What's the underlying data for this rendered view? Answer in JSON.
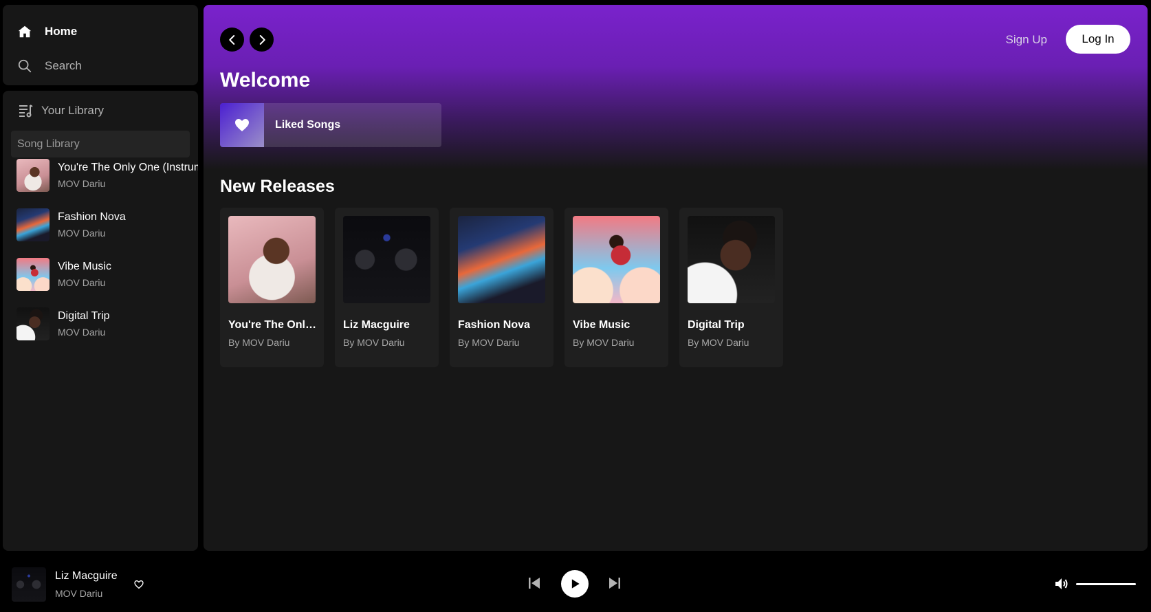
{
  "sidebar": {
    "nav": {
      "home_label": "Home",
      "search_label": "Search"
    },
    "library": {
      "title": "Your Library",
      "search_placeholder": "Song Library",
      "items": [
        {
          "title": "You're The Only One (Instrumental)",
          "artist": "MOV Dariu",
          "art": "art-1"
        },
        {
          "title": "Fashion Nova",
          "artist": "MOV Dariu",
          "art": "art-3"
        },
        {
          "title": "Vibe Music",
          "artist": "MOV Dariu",
          "art": "art-4"
        },
        {
          "title": "Digital Trip",
          "artist": "MOV Dariu",
          "art": "art-5"
        }
      ]
    }
  },
  "header": {
    "back_icon": "chevron-left-icon",
    "forward_icon": "chevron-right-icon",
    "signup_label": "Sign Up",
    "login_label": "Log In"
  },
  "main": {
    "welcome_title": "Welcome",
    "liked_songs_label": "Liked Songs",
    "new_releases_title": "New Releases",
    "releases": [
      {
        "title": "You're The Only One (Instrumental)",
        "artist": "By MOV Dariu",
        "art": "art-1"
      },
      {
        "title": "Liz Macguire",
        "artist": "By MOV Dariu",
        "art": "art-2"
      },
      {
        "title": "Fashion Nova",
        "artist": "By MOV Dariu",
        "art": "art-3"
      },
      {
        "title": "Vibe Music",
        "artist": "By MOV Dariu",
        "art": "art-4"
      },
      {
        "title": "Digital Trip",
        "artist": "By MOV Dariu",
        "art": "art-5"
      }
    ]
  },
  "player": {
    "now_playing": {
      "title": "Liz Macguire",
      "artist": "MOV Dariu",
      "art": "art-2"
    },
    "volume": 1.0
  },
  "colors": {
    "accent": "#7a22cc",
    "background": "#000000",
    "panel": "#171717",
    "card": "#1f1f1f",
    "muted_text": "#a7a7a7"
  }
}
